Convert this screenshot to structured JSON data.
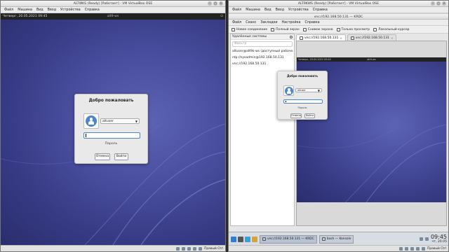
{
  "left_window": {
    "title": "ALTWKS (Ready) [Работает] - VM VirtualBox OSE",
    "menu": [
      "Файл",
      "Машина",
      "Вид",
      "Ввод",
      "Устройства",
      "Справка"
    ],
    "guest_topbar": {
      "datetime": "Четверг, 20.05.2021 09:45",
      "hostname": "alt9-ws"
    },
    "login": {
      "title": "Добро пожаловать",
      "user": "altuser",
      "password_value": "",
      "password_label": "Пароль",
      "cancel": "Отмена",
      "login": "Войти"
    },
    "status_hostkey": "Правый Ctrl"
  },
  "right_window": {
    "title": "ALT9KWS (Ready) [Работает] - VM VirtualBox OSE",
    "menu": [
      "Файл",
      "Машина",
      "Вид",
      "Ввод",
      "Устройства",
      "Справка"
    ],
    "app_title": "vnc://192.168.50.131 — KRDC",
    "app_menu": [
      "Файл",
      "Сеанс",
      "Закладки",
      "Настройка",
      "Справка"
    ],
    "toolbar": [
      "Новое соединение",
      "Полный экран",
      "Снимок экрана",
      "Только просмотр",
      "Локальный курсор"
    ],
    "sidebar": {
      "title": "Удалённые системы",
      "filter_placeholder": "Фильтр",
      "items": [
        "altuser@alt9k-ws (доступный рабоче...",
        "rdp://sysadmin@192.168.50.131",
        "vnc://192.168.50.131"
      ]
    },
    "tabs": [
      "vnc://192.168.50.131",
      "vnc://192.168.50.131"
    ],
    "remote": {
      "datetime": "Четверг, 20.05.2021 09:45",
      "hostname": "alt9-ws",
      "login": {
        "title": "Добро пожаловать",
        "user": "altuser",
        "password_label": "Пароль",
        "cancel": "Отмена",
        "login": "Войти"
      }
    },
    "taskbar": {
      "tasks": [
        "vnc://192.168.50.131 — KRDC",
        "bash — Konsole"
      ],
      "time": "09:45",
      "date": "чт, 20.05"
    },
    "status_hostkey": "Правый Ctrl"
  },
  "colors": {
    "wallpaper": "#4a4fa0",
    "accent": "#4a86c8"
  }
}
